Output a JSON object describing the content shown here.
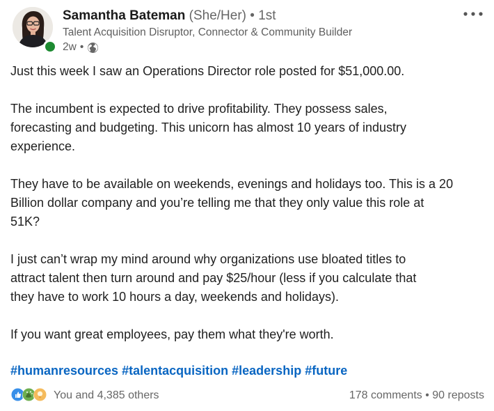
{
  "author": {
    "name": "Samantha Bateman",
    "pronouns": "(She/Her)",
    "separator": "•",
    "degree": "1st",
    "headline": "Talent Acquisition Disruptor, Connector & Community Builder",
    "time": "2w",
    "time_separator": "•",
    "visibility_icon": "globe-icon",
    "online_status_color": "#1d8a31"
  },
  "menu": {
    "icon": "more-horizontal-icon"
  },
  "post": {
    "paragraphs": [
      "Just this week I saw an Operations Director role posted for $51,000.00.",
      "The incumbent is expected to drive profitability.  They possess sales,\nforecasting and budgeting. This unicorn has almost 10 years of industry\nexperience.",
      "They have to be available on weekends, evenings and holidays too. This is a 20\nBillion dollar company and you’re telling me that they only value this role at\n51K?",
      "I just can’t wrap my mind around why organizations use bloated titles to\nattract talent then turn around and pay $25/hour (less if you calculate that\nthey have to work 10 hours a day, weekends and holidays).",
      "If you want great employees, pay them what they're worth."
    ],
    "hashtags": [
      "#humanresources",
      "#talentacquisition",
      "#leadership",
      "#future"
    ]
  },
  "social": {
    "reaction_icons": [
      "like-icon",
      "celebrate-icon",
      "insightful-icon"
    ],
    "reactions_text": "You and 4,385 others",
    "comments": "178 comments",
    "separator": "•",
    "reposts": "90 reposts"
  },
  "colors": {
    "link": "#0a66c2",
    "meta_text": "#666666",
    "like": "#378fe9",
    "celebrate": "#44712e",
    "insightful": "#e7a33e"
  }
}
